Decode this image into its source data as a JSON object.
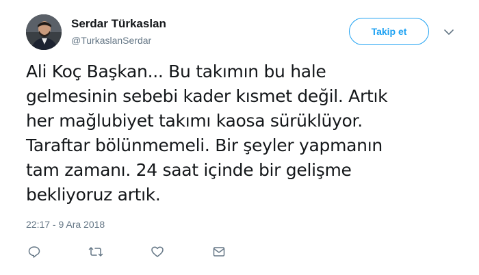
{
  "author": {
    "name": "Serdar Türkaslan",
    "handle": "@TurkaslanSerdar"
  },
  "follow_button": {
    "label": "Takip et"
  },
  "tweet": {
    "lines": [
      "Ali Koç Başkan... Bu takımın bu hale",
      "gelmesinin sebebi kader kısmet değil. Artık",
      "her mağlubiyet takımı kaosa sürüklüyor.",
      "Taraftar bölünmemeli. Bir şeyler yapmanın",
      "tam zamanı. 24 saat içinde bir gelişme",
      "bekliyoruz artık."
    ],
    "timestamp": "22:17 - 9 Ara 2018"
  },
  "actions": [
    {
      "icon": "reply-icon"
    },
    {
      "icon": "retweet-icon"
    },
    {
      "icon": "like-icon"
    },
    {
      "icon": "message-icon"
    }
  ],
  "colors": {
    "accent": "#1da1f2",
    "secondary_text": "#657786",
    "primary_text": "#14171a"
  }
}
